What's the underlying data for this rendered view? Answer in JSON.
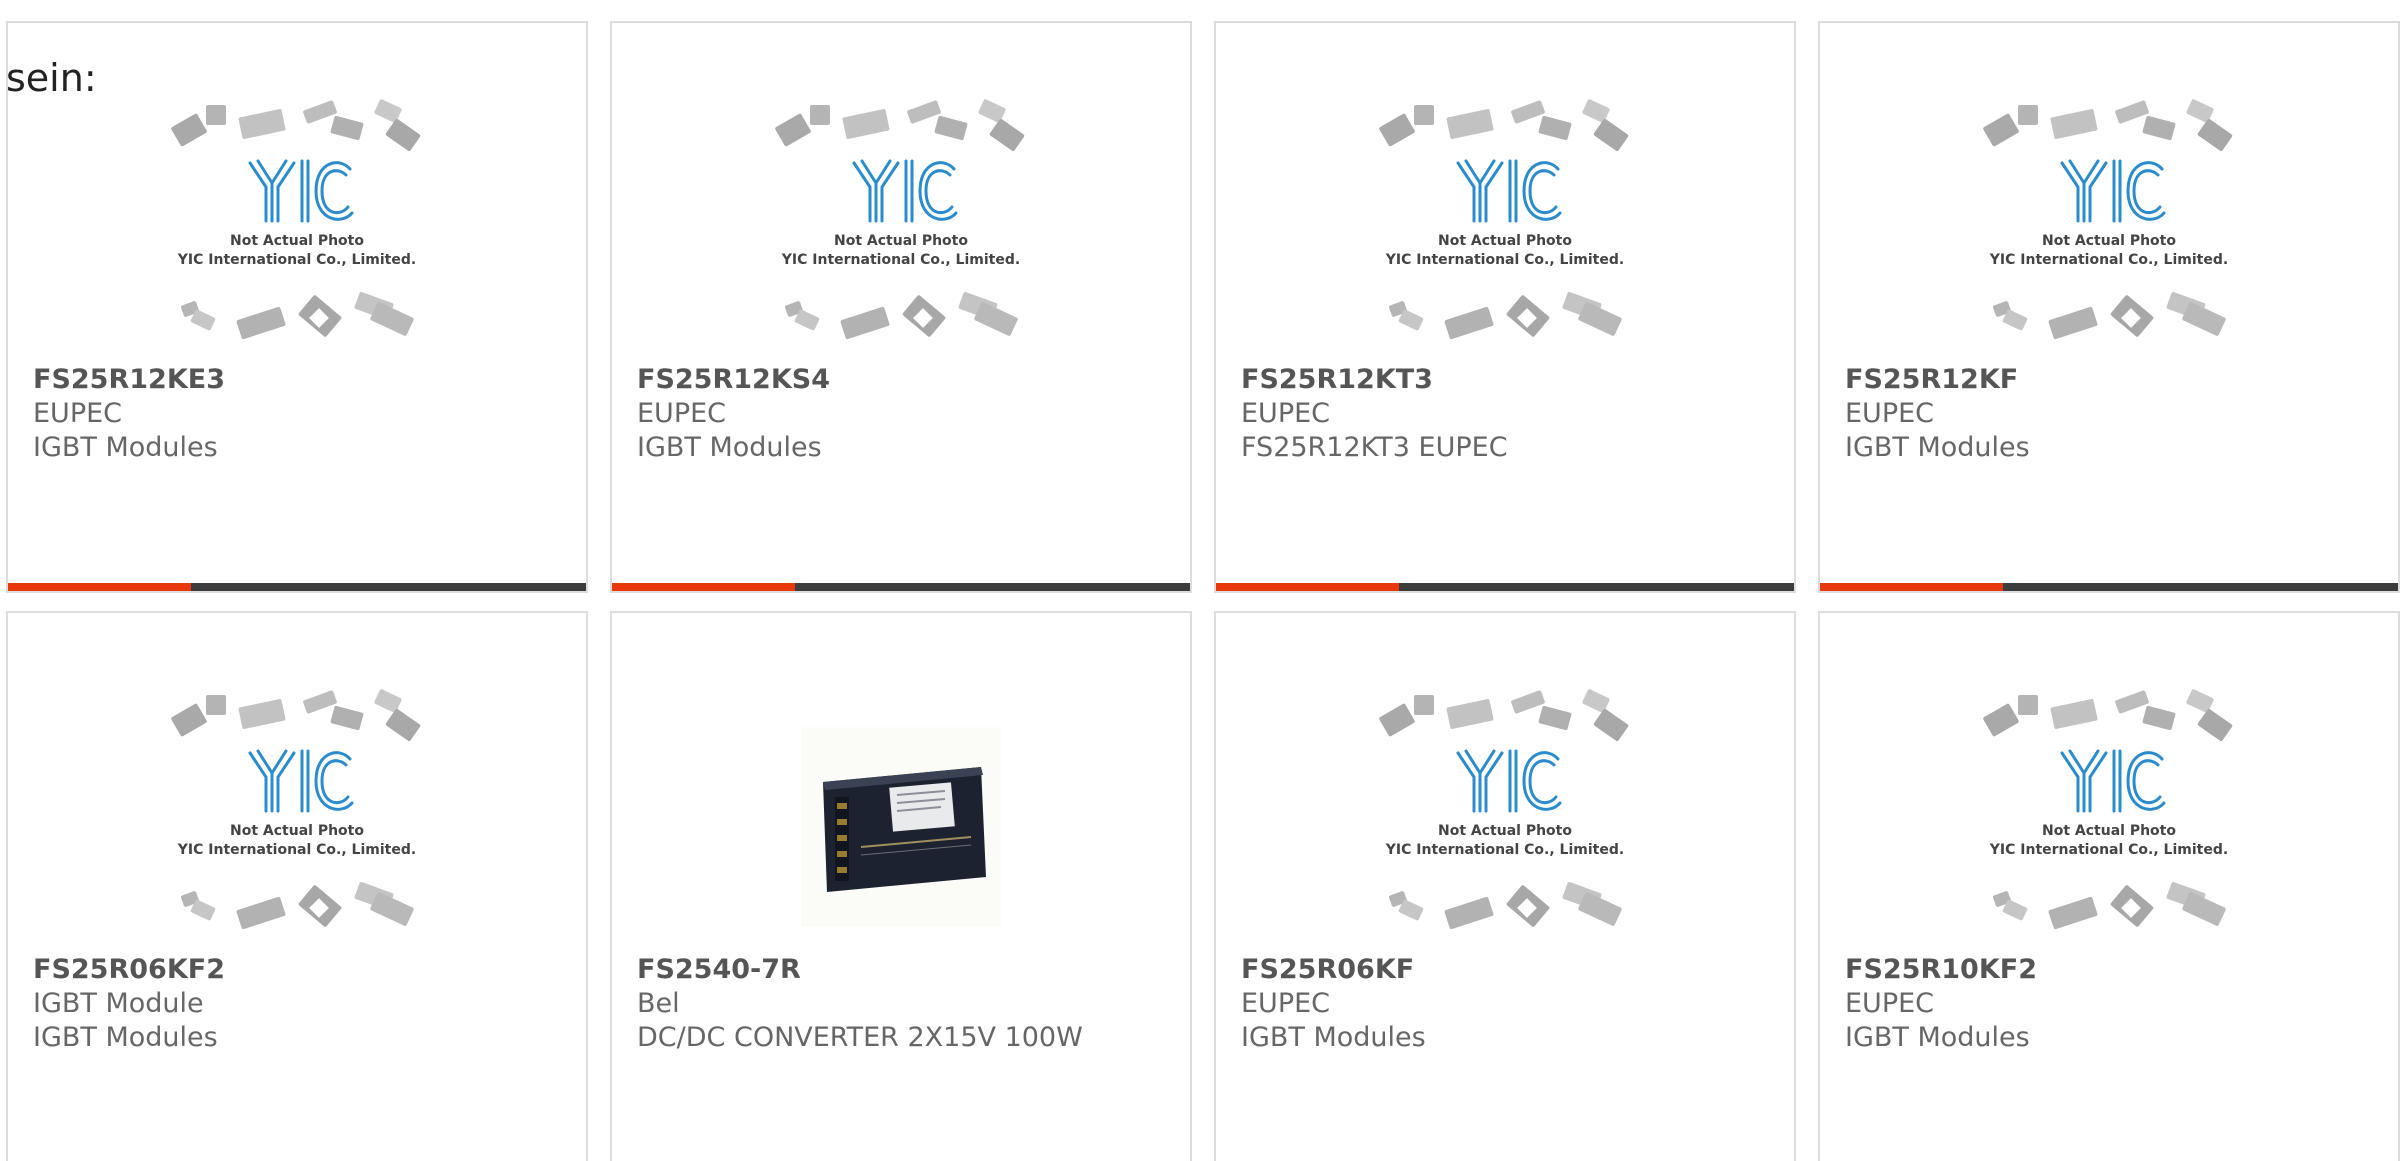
{
  "intro_text": "sein:",
  "colors": {
    "accent_bar": "#e8380d",
    "dark_bar": "#3c3c3c",
    "logo_blue": "#2b8ccd"
  },
  "placeholder": {
    "logo_text": "YIC",
    "line1": "Not Actual Photo",
    "line2": "YIC International Co., Limited."
  },
  "products": [
    {
      "part": "FS25R12KE3",
      "maker": "EUPEC",
      "description": "IGBT Modules",
      "image": "placeholder-icon"
    },
    {
      "part": "FS25R12KS4",
      "maker": "EUPEC",
      "description": "IGBT Modules",
      "image": "placeholder-icon"
    },
    {
      "part": "FS25R12KT3",
      "maker": "EUPEC",
      "description": "FS25R12KT3 EUPEC",
      "image": "placeholder-icon"
    },
    {
      "part": "FS25R12KF",
      "maker": "EUPEC",
      "description": "IGBT Modules",
      "image": "placeholder-icon"
    },
    {
      "part": "FS25R06KF2",
      "maker": "IGBT Module",
      "description": "IGBT Modules",
      "image": "placeholder-icon"
    },
    {
      "part": "FS2540-7R",
      "maker": "Bel",
      "description": "DC/DC CONVERTER 2X15V 100W",
      "image": "product-photo"
    },
    {
      "part": "FS25R06KF",
      "maker": "EUPEC",
      "description": "IGBT Modules",
      "image": "placeholder-icon"
    },
    {
      "part": "FS25R10KF2",
      "maker": "EUPEC",
      "description": "IGBT Modules",
      "image": "placeholder-icon"
    }
  ]
}
